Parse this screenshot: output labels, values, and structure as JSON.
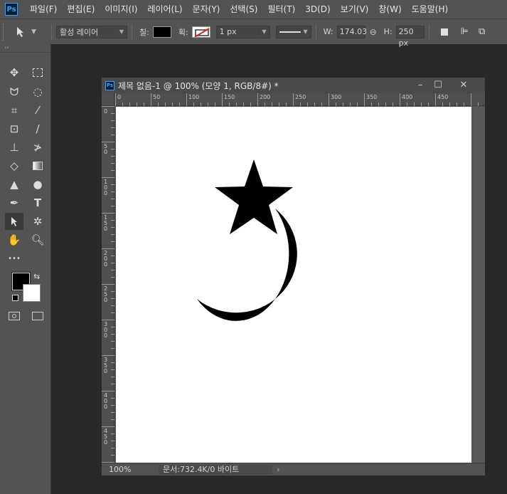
{
  "app": {
    "logo": "Ps",
    "accent": "#31a8ff"
  },
  "menu": [
    "파일(F)",
    "편집(E)",
    "이미지(I)",
    "레이어(L)",
    "문자(Y)",
    "선택(S)",
    "필터(T)",
    "3D(D)",
    "보기(V)",
    "창(W)",
    "도움말(H)"
  ],
  "options": {
    "tool_icon": "arrow-pointer-icon",
    "selection_mode": "활성 레이어",
    "fill_label": "칠:",
    "fill_color": "#000000",
    "stroke_label": "획:",
    "stroke_width": "1 px",
    "w_label": "W:",
    "w_value": "174.03",
    "h_label": "H:",
    "h_value": "250 px"
  },
  "toolbar": {
    "collapse": "‹‹",
    "more": "•••",
    "fg_color": "#000000",
    "bg_color": "#ffffff"
  },
  "document": {
    "title": "제목 없음-1 @ 100% (모양 1, RGB/8#) *",
    "zoom": "100%",
    "doc_info": "문서:732.4K/0 바이트",
    "shape_color": "#000000",
    "ruler_h": [
      "0",
      "50",
      "100",
      "150",
      "200",
      "250",
      "300",
      "350",
      "400",
      "450"
    ],
    "ruler_v": [
      "0",
      "50",
      "100",
      "150",
      "200",
      "250",
      "300",
      "350",
      "400",
      "450"
    ]
  }
}
